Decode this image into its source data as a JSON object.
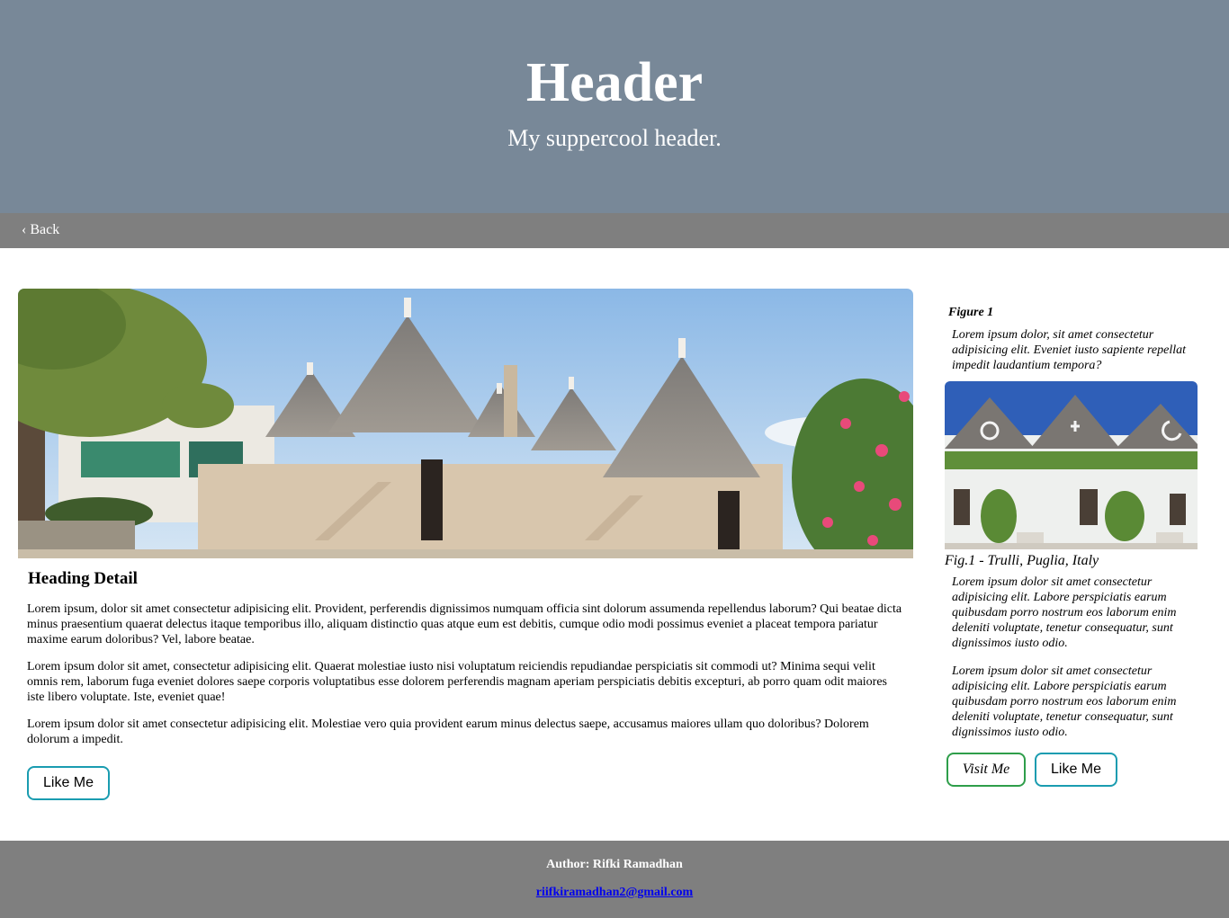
{
  "header": {
    "title": "Header",
    "subtitle": "My suppercool header."
  },
  "nav": {
    "back_label": "‹ Back"
  },
  "article": {
    "image_alt": "Trulli houses",
    "heading": "Heading Detail",
    "paragraphs": [
      "Lorem ipsum, dolor sit amet consectetur adipisicing elit. Provident, perferendis dignissimos numquam officia sint dolorum assumenda repellendus laborum? Qui beatae dicta minus praesentium quaerat delectus itaque temporibus illo, aliquam distinctio quas atque eum est debitis, cumque odio modi possimus eveniet a placeat tempora pariatur maxime earum doloribus? Vel, labore beatae.",
      "Lorem ipsum dolor sit amet, consectetur adipisicing elit. Quaerat molestiae iusto nisi voluptatum reiciendis repudiandae perspiciatis sit commodi ut? Minima sequi velit omnis rem, laborum fuga eveniet dolores saepe corporis voluptatibus esse dolorem perferendis magnam aperiam perspiciatis debitis excepturi, ab porro quam odit maiores iste libero voluptate. Iste, eveniet quae!",
      "Lorem ipsum dolor sit amet consectetur adipisicing elit. Molestiae vero quia provident earum minus delectus saepe, accusamus maiores ullam quo doloribus? Dolorem dolorum a impedit."
    ],
    "like_button": "Like Me"
  },
  "aside": {
    "figure_title": "Figure 1",
    "intro": "Lorem ipsum dolor, sit amet consectetur adipisicing elit. Eveniet iusto sapiente repellat impedit laudantium tempora?",
    "caption": "Fig.1 - Trulli, Puglia, Italy",
    "paragraphs": [
      "Lorem ipsum dolor sit amet consectetur adipisicing elit. Labore perspiciatis earum quibusdam porro nostrum eos laborum enim deleniti voluptate, tenetur consequatur, sunt dignissimos iusto odio.",
      "Lorem ipsum dolor sit amet consectetur adipisicing elit. Labore perspiciatis earum quibusdam porro nostrum eos laborum enim deleniti voluptate, tenetur consequatur, sunt dignissimos iusto odio."
    ],
    "visit_button": "Visit Me",
    "like_button": "Like Me"
  },
  "footer": {
    "author": "Author: Rifki Ramadhan",
    "email": "riifkiramadhan2@gmail.com"
  },
  "colors": {
    "header_bg": "#788898",
    "nav_bg": "#7f7f7f",
    "footer_bg": "#7f7f7f",
    "like_border": "#1a9cb0",
    "visit_border": "#2e9e4a"
  }
}
